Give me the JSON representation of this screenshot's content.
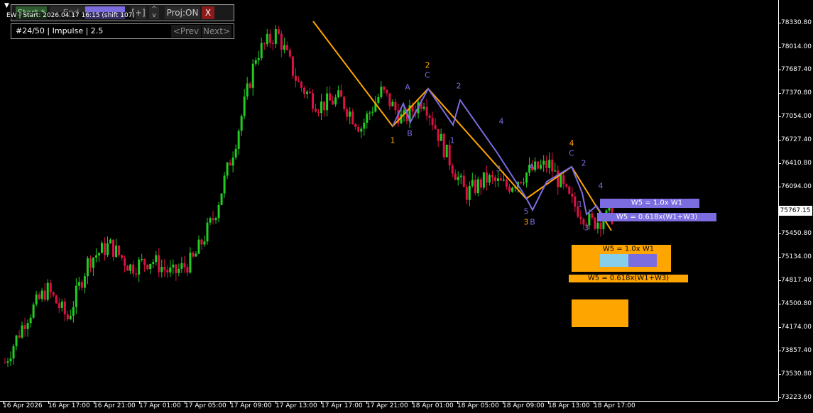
{
  "toolbar": {
    "start_label": "Start *",
    "end_label": "End",
    "mode_label": "",
    "plus_label": "[+]",
    "up_label": "^",
    "down_label": "v",
    "proj_label": "Proj:ON",
    "close_label": "X"
  },
  "status": {
    "ew_label": "EW | Start: 2026.04.17 16:15 (shift 107)"
  },
  "nav": {
    "info": "#24/50 | Impulse | 2.5",
    "prev_label": "<Prev",
    "next_label": "Next>"
  },
  "current_price": "75767.15",
  "colors": {
    "up": "#22cc22",
    "down": "#dd1144",
    "wave_major": "#ffa500",
    "wave_minor": "#7b6ce0",
    "projection_light": "#87ceeb",
    "axis": "#ffffff"
  },
  "wave_labels": [
    {
      "text": "2",
      "color": "#ffa500"
    },
    {
      "text": "C",
      "color": "#7b6ce0"
    },
    {
      "text": "A",
      "color": "#7b6ce0"
    },
    {
      "text": "B",
      "color": "#7b6ce0"
    },
    {
      "text": "1",
      "color": "#ffa500"
    },
    {
      "text": "2",
      "color": "#7b6ce0"
    },
    {
      "text": "1",
      "color": "#7b6ce0"
    },
    {
      "text": "4",
      "color": "#7b6ce0"
    },
    {
      "text": "3",
      "color": "#7b6ce0"
    },
    {
      "text": "A",
      "color": "#7b6ce0"
    },
    {
      "text": "5",
      "color": "#7b6ce0"
    },
    {
      "text": "3",
      "color": "#ffa500"
    },
    {
      "text": "B",
      "color": "#7b6ce0"
    },
    {
      "text": "4",
      "color": "#ffa500"
    },
    {
      "text": "C",
      "color": "#7b6ce0"
    },
    {
      "text": "2",
      "color": "#7b6ce0"
    },
    {
      "text": "1",
      "color": "#7b6ce0"
    },
    {
      "text": "4",
      "color": "#7b6ce0"
    },
    {
      "text": "3",
      "color": "#7b6ce0"
    }
  ],
  "projection_labels": {
    "purple_w5_1x": "W5 = 1.0x W1",
    "purple_w5_0618": "W5 = 0.618x(W1+W3)",
    "orange_w5_1x": "W5 = 1.0x W1",
    "orange_w5_0618": "W5 = 0.618x(W1+W3)"
  },
  "y_axis": [
    "78330.80",
    "78014.00",
    "77687.40",
    "77370.80",
    "77054.00",
    "76727.40",
    "76410.80",
    "76094.00",
    "75767.15",
    "75450.80",
    "75134.00",
    "74817.40",
    "74500.80",
    "74174.00",
    "73857.40",
    "73530.80",
    "73223.60"
  ],
  "x_axis": [
    "16 Apr 2026",
    "16 Apr 17:00",
    "16 Apr 21:00",
    "17 Apr 01:00",
    "17 Apr 05:00",
    "17 Apr 09:00",
    "17 Apr 13:00",
    "17 Apr 17:00",
    "17 Apr 21:00",
    "18 Apr 01:00",
    "18 Apr 05:00",
    "18 Apr 09:00",
    "18 Apr 13:00",
    "18 Apr 17:00"
  ],
  "chart_data": {
    "type": "candlestick",
    "symbol_price_range": [
      73223.6,
      78330.8
    ],
    "price_path": [
      73700,
      74300,
      74700,
      74300,
      75100,
      75300,
      75000,
      75100,
      74900,
      75100,
      75700,
      76700,
      77900,
      78200,
      77500,
      77200,
      77300,
      76900,
      77400,
      77000,
      77300,
      76600,
      76000,
      76200,
      76100,
      76300,
      76400,
      75900,
      75600,
      75700
    ]
  }
}
